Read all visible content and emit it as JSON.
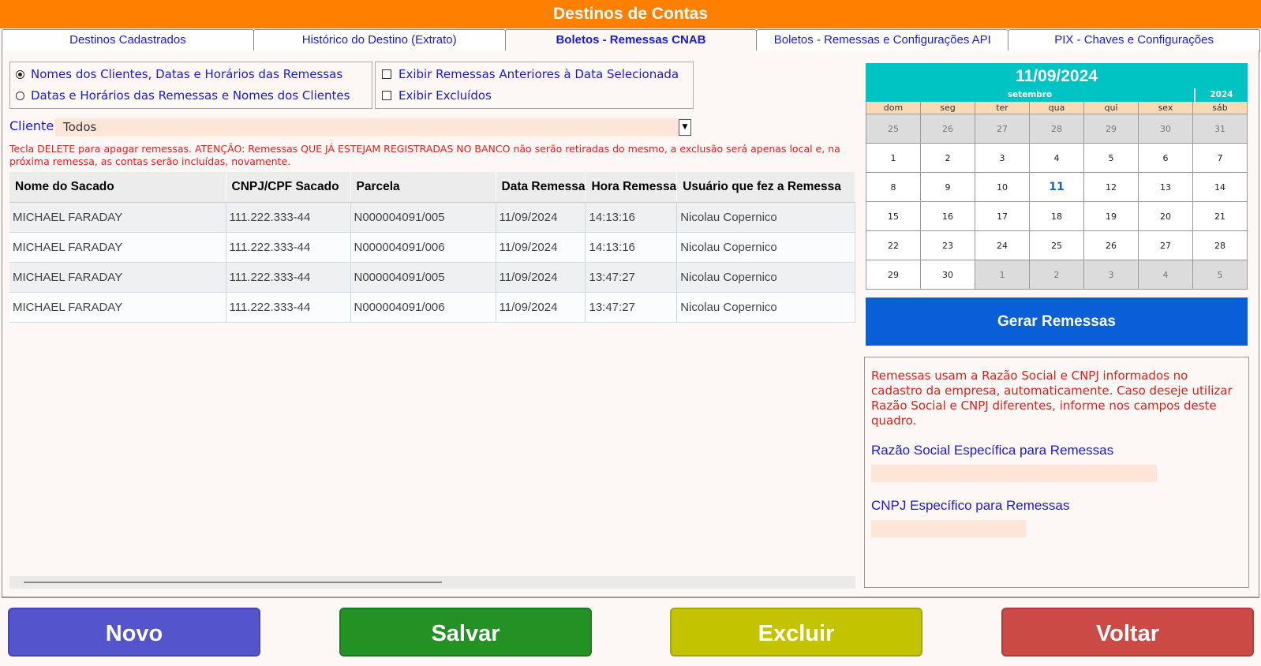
{
  "window": {
    "title": "Destinos de Contas"
  },
  "tabs": [
    {
      "label": "Destinos Cadastrados",
      "active": false
    },
    {
      "label": "Histórico do Destino (Extrato)",
      "active": false
    },
    {
      "label": "Boletos - Remessas CNAB",
      "active": true
    },
    {
      "label": "Boletos - Remessas e Configurações API",
      "active": false
    },
    {
      "label": "PIX - Chaves e Configurações",
      "active": false
    }
  ],
  "sort_options": {
    "option1": {
      "label": "Nomes dos Clientes, Datas e Horários das Remessas",
      "selected": true
    },
    "option2": {
      "label": "Datas e Horários das Remessas e Nomes dos Clientes",
      "selected": false
    }
  },
  "filters": {
    "show_previous": {
      "label": "Exibir Remessas Anteriores à Data Selecionada",
      "checked": false
    },
    "show_deleted": {
      "label": "Exibir Excluídos",
      "checked": false
    }
  },
  "client": {
    "label": "Cliente",
    "value": "Todos"
  },
  "warning": "Tecla DELETE para apagar remessas. ATENÇÃO: Remessas QUE JÁ ESTEJAM REGISTRADAS NO BANCO não serão retiradas do mesmo, a exclusão será apenas local e, na próxima remessa, as contas serão incluídas, novamente.",
  "table": {
    "headers": [
      "Nome do Sacado",
      "CNPJ/CPF Sacado",
      "Parcela",
      "Data Remessa",
      "Hora Remessa",
      "Usuário que fez a Remessa"
    ],
    "rows": [
      [
        "MICHAEL FARADAY",
        "111.222.333-44",
        "N000004091/005",
        "11/09/2024",
        "14:13:16",
        "Nicolau Copernico"
      ],
      [
        "MICHAEL FARADAY",
        "111.222.333-44",
        "N000004091/006",
        "11/09/2024",
        "14:13:16",
        "Nicolau Copernico"
      ],
      [
        "MICHAEL FARADAY",
        "111.222.333-44",
        "N000004091/005",
        "11/09/2024",
        "13:47:27",
        "Nicolau Copernico"
      ],
      [
        "MICHAEL FARADAY",
        "111.222.333-44",
        "N000004091/006",
        "11/09/2024",
        "13:47:27",
        "Nicolau Copernico"
      ]
    ]
  },
  "calendar": {
    "selected_date": "11/09/2024",
    "month": "setembro",
    "year": "2024",
    "weekdays": [
      "dom",
      "seg",
      "ter",
      "qua",
      "qui",
      "sex",
      "sáb"
    ],
    "days": [
      {
        "n": "25",
        "other": true
      },
      {
        "n": "26",
        "other": true
      },
      {
        "n": "27",
        "other": true
      },
      {
        "n": "28",
        "other": true
      },
      {
        "n": "29",
        "other": true
      },
      {
        "n": "30",
        "other": true
      },
      {
        "n": "31",
        "other": true
      },
      {
        "n": "1"
      },
      {
        "n": "2"
      },
      {
        "n": "3"
      },
      {
        "n": "4"
      },
      {
        "n": "5"
      },
      {
        "n": "6"
      },
      {
        "n": "7"
      },
      {
        "n": "8"
      },
      {
        "n": "9"
      },
      {
        "n": "10"
      },
      {
        "n": "11",
        "sel": true
      },
      {
        "n": "12"
      },
      {
        "n": "13"
      },
      {
        "n": "14"
      },
      {
        "n": "15"
      },
      {
        "n": "16"
      },
      {
        "n": "17"
      },
      {
        "n": "18"
      },
      {
        "n": "19"
      },
      {
        "n": "20"
      },
      {
        "n": "21"
      },
      {
        "n": "22"
      },
      {
        "n": "23"
      },
      {
        "n": "24"
      },
      {
        "n": "25"
      },
      {
        "n": "26"
      },
      {
        "n": "27"
      },
      {
        "n": "28"
      },
      {
        "n": "29"
      },
      {
        "n": "30"
      },
      {
        "n": "1",
        "other": true
      },
      {
        "n": "2",
        "other": true
      },
      {
        "n": "3",
        "other": true
      },
      {
        "n": "4",
        "other": true
      },
      {
        "n": "5",
        "other": true
      }
    ]
  },
  "generate_button": "Gerar Remessas",
  "info": {
    "text": "Remessas usam a Razão Social e CNPJ informados no cadastro da empresa, automaticamente. Caso deseje utilizar Razão Social e CNPJ diferentes, informe nos campos deste quadro.",
    "razao_label": "Razão Social Específica para Remessas",
    "razao_value": "",
    "cnpj_label": "CNPJ Específico para Remessas",
    "cnpj_value": ""
  },
  "buttons": {
    "novo": "Novo",
    "salvar": "Salvar",
    "excluir": "Excluir",
    "voltar": "Voltar"
  },
  "colors": {
    "title_bar": "#ff8000",
    "calendar": "#00c3c3",
    "gerar": "#0a5ed8",
    "novo": "#5454cc",
    "salvar": "#239123",
    "excluir": "#c3c300",
    "voltar": "#cc4a45"
  }
}
